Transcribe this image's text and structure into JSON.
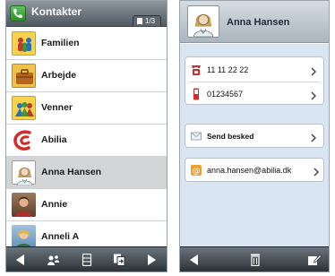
{
  "left": {
    "title": "Kontakter",
    "page_indicator": "1/3",
    "contacts": [
      {
        "label": "Familien",
        "icon": "family-icon"
      },
      {
        "label": "Arbejde",
        "icon": "briefcase-icon"
      },
      {
        "label": "Venner",
        "icon": "friends-icon"
      },
      {
        "label": "Abilia",
        "icon": "abilia-logo-icon"
      },
      {
        "label": "Anna Hansen",
        "icon": "person-avatar-icon",
        "selected": true
      },
      {
        "label": "Annie",
        "icon": "person-photo-icon"
      },
      {
        "label": "Anneli A",
        "icon": "person-photo-icon"
      }
    ],
    "toolbar": [
      "back-arrow-icon",
      "add-contact-icon",
      "sim-card-icon",
      "copy-icon",
      "forward-arrow-icon"
    ]
  },
  "right": {
    "name": "Anna Hansen",
    "phone_home": "11 11 22 22",
    "phone_mobile": "01234567",
    "send_message": "Send besked",
    "email": "anna.hansen@abilia.dk",
    "toolbar": [
      "back-arrow-icon",
      "trash-icon",
      "edit-icon"
    ]
  },
  "colors": {
    "header_dark": "#4f5860",
    "selected_row": "#d2d4d6",
    "detail_background": "#d9e5f0",
    "accent_red": "#d22b2b"
  }
}
